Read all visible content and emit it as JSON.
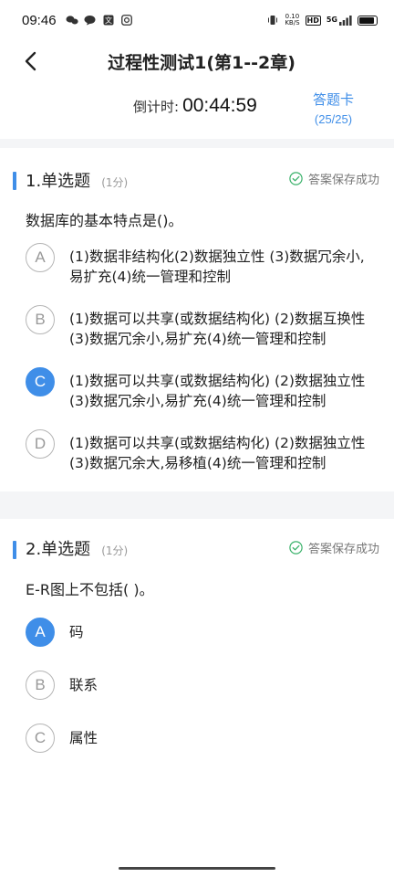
{
  "status_bar": {
    "time": "09:46",
    "network_speed_value": "0.10",
    "network_speed_unit": "KB/S",
    "hd_label": "HD",
    "signal_label": "5G"
  },
  "header": {
    "title": "过程性测试1(第1--2章)"
  },
  "timer": {
    "label": "倒计时:",
    "value": "00:44:59"
  },
  "answer_card": {
    "label": "答题卡",
    "progress": "(25/25)"
  },
  "questions": [
    {
      "number_type": "1.单选题",
      "score": "(1分)",
      "save_status": "答案保存成功",
      "stem": "数据库的基本特点是()。",
      "options": [
        {
          "letter": "A",
          "text": "(1)数据非结构化(2)数据独立性 (3)数据冗余小,易扩充(4)统一管理和控制",
          "selected": false
        },
        {
          "letter": "B",
          "text": "(1)数据可以共享(或数据结构化) (2)数据互换性(3)数据冗余小,易扩充(4)统一管理和控制",
          "selected": false
        },
        {
          "letter": "C",
          "text": "(1)数据可以共享(或数据结构化) (2)数据独立性 (3)数据冗余小,易扩充(4)统一管理和控制",
          "selected": true
        },
        {
          "letter": "D",
          "text": "(1)数据可以共享(或数据结构化) (2)数据独立性(3)数据冗余大,易移植(4)统一管理和控制",
          "selected": false
        }
      ]
    },
    {
      "number_type": "2.单选题",
      "score": "(1分)",
      "save_status": "答案保存成功",
      "stem": "E-R图上不包括( )。",
      "options": [
        {
          "letter": "A",
          "text": "码",
          "selected": true
        },
        {
          "letter": "B",
          "text": "联系",
          "selected": false
        },
        {
          "letter": "C",
          "text": "属性",
          "selected": false
        }
      ]
    }
  ],
  "colors": {
    "accent": "#3f8ee8",
    "save_check": "#3bb26b"
  }
}
